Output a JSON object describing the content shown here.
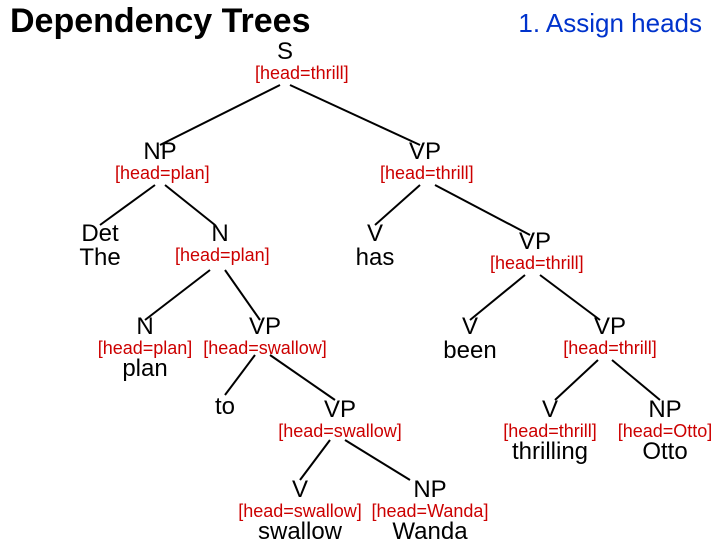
{
  "title": "Dependency Trees",
  "subtitle": "1. Assign heads",
  "annot_prefix": "[head=",
  "annot_suffix": "]",
  "nodes": {
    "S": {
      "label": "S",
      "head": "thrill",
      "terminal": ""
    },
    "NP": {
      "label": "NP",
      "head": "plan",
      "terminal": ""
    },
    "VP": {
      "label": "VP",
      "head": "thrill",
      "terminal": ""
    },
    "Det": {
      "label": "Det",
      "head": "",
      "terminal": "The"
    },
    "N": {
      "label": "N",
      "head": "plan",
      "terminal": ""
    },
    "V_has": {
      "label": "V",
      "head": "",
      "terminal": "has"
    },
    "VP2": {
      "label": "VP",
      "head": "thrill",
      "terminal": ""
    },
    "N_plan": {
      "label": "N",
      "head": "plan",
      "terminal": "plan"
    },
    "VP_swallow": {
      "label": "VP",
      "head": "swallow",
      "terminal": ""
    },
    "V_been": {
      "label": "V",
      "head": "",
      "terminal": "been"
    },
    "VP3": {
      "label": "VP",
      "head": "thrill",
      "terminal": ""
    },
    "to": {
      "label": "",
      "head": "",
      "terminal": "to"
    },
    "VP_swallow2": {
      "label": "VP",
      "head": "swallow",
      "terminal": ""
    },
    "V_thrill": {
      "label": "V",
      "head": "thrill",
      "terminal": "thrilling"
    },
    "NP_Otto": {
      "label": "NP",
      "head": "Otto",
      "terminal": "Otto"
    },
    "V_swallow": {
      "label": "V",
      "head": "swallow",
      "terminal": "swallow"
    },
    "NP_Wanda": {
      "label": "NP",
      "head": "Wanda",
      "terminal": "Wanda"
    }
  }
}
